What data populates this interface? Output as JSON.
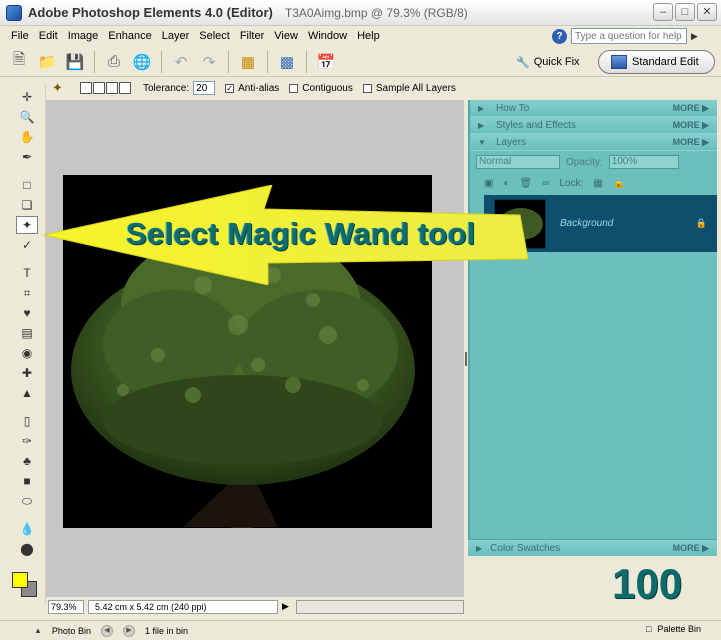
{
  "window": {
    "app_title": "Adobe Photoshop Elements 4.0 (Editor)",
    "document_title": "T3A0Aimg.bmp @ 79.3% (RGB/8)",
    "controls": [
      "minimize",
      "maximize",
      "close"
    ]
  },
  "menu": [
    "File",
    "Edit",
    "Image",
    "Enhance",
    "Layer",
    "Select",
    "Filter",
    "View",
    "Window",
    "Help"
  ],
  "help": {
    "placeholder": "Type a question for help"
  },
  "modes": {
    "quick_fix": "Quick Fix",
    "standard_edit": "Standard Edit"
  },
  "options_bar": {
    "tolerance_label": "Tolerance:",
    "tolerance_value": "20",
    "anti_alias": "Anti-alias",
    "contiguous": "Contiguous",
    "sample_all_layers": "Sample All Layers"
  },
  "callout": {
    "text": "Select Magic Wand tool"
  },
  "palette_bin": {
    "how_to": "How To",
    "styles_effects": "Styles and Effects",
    "layers": "Layers",
    "more": "MORE",
    "blend_mode": "Normal",
    "opacity_label": "Opacity:",
    "opacity_value": "100%",
    "lock_label": "Lock:",
    "layer_name": "Background",
    "color_swatches": "Color Swatches"
  },
  "status": {
    "zoom": "79.3%",
    "doc_size": "5.42 cm x 5.42 cm (240 ppi)"
  },
  "bottom_bar": {
    "photo_bin": "Photo Bin",
    "files_in_bin": "1 file in bin",
    "palette_bin": "Palette Bin"
  },
  "counter": "100",
  "colors": {
    "foreground": "#ffff00",
    "background": "#8a8a8a",
    "palette": "#6bbfbc",
    "callout": "#f5f530"
  }
}
